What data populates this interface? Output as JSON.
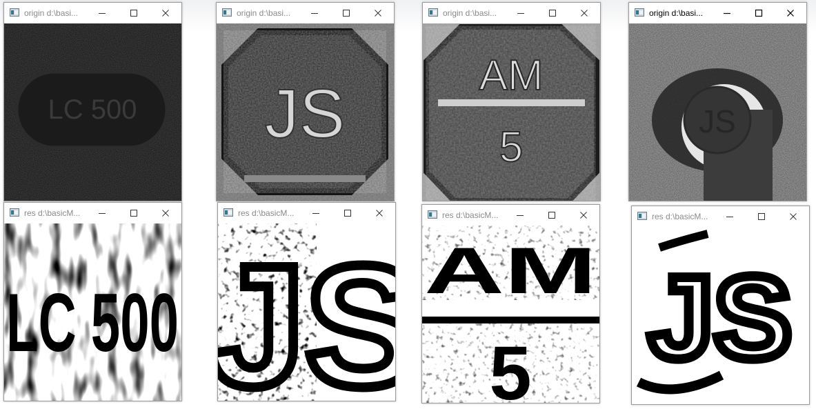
{
  "windows": [
    {
      "title": "origin d:\\basi...",
      "active": false
    },
    {
      "title": "origin d:\\basi...",
      "active": false
    },
    {
      "title": "origin d:\\basi...",
      "active": false
    },
    {
      "title": "origin d:\\basi...",
      "active": true
    },
    {
      "title": "res d:\\basicM...",
      "active": false
    },
    {
      "title": "res d:\\basicM...",
      "active": false
    },
    {
      "title": "res d:\\basicM...",
      "active": false
    },
    {
      "title": "res d:\\basicM...",
      "active": false
    }
  ],
  "image_text": {
    "origin_1": "LC 500",
    "origin_2": "JS",
    "origin_3_top": "AM",
    "origin_3_bottom": "5",
    "origin_4": "JS",
    "res_1": "LC 500",
    "res_2": "JS",
    "res_3_top": "AM",
    "res_3_bottom": "5",
    "res_4": "JS"
  },
  "icons": [
    "app-icon",
    "minimize-icon",
    "maximize-icon",
    "close-icon"
  ]
}
